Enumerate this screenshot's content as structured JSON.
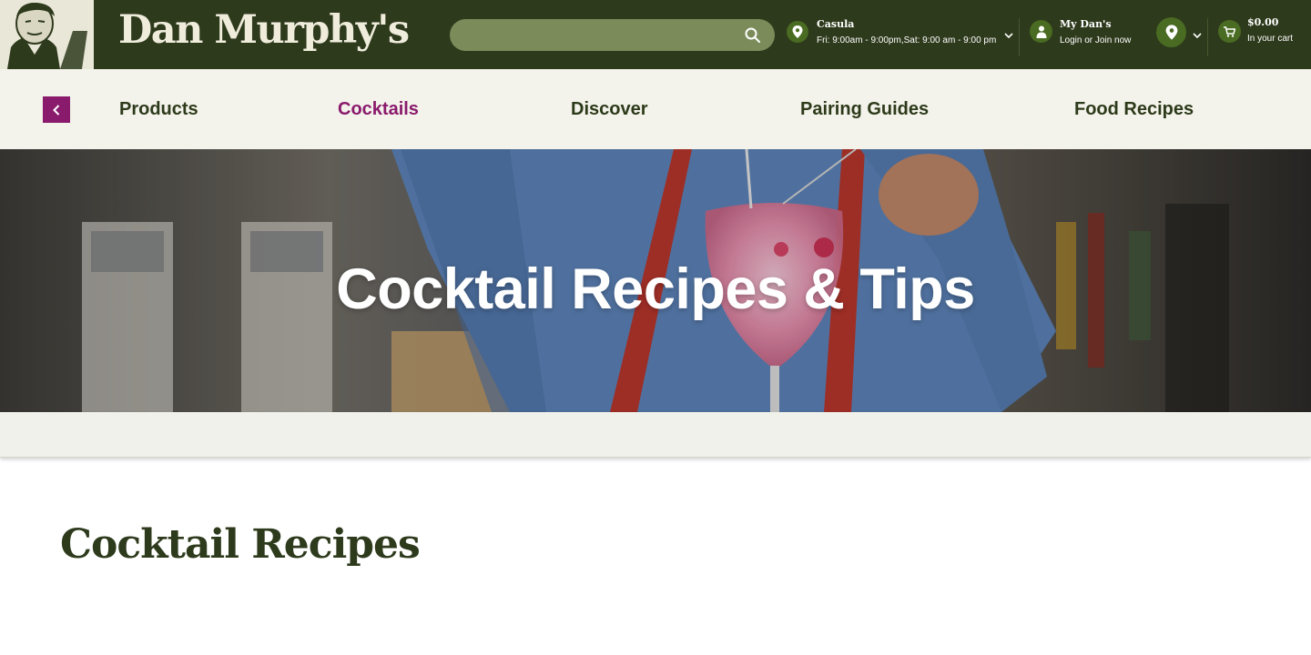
{
  "header": {
    "logo_text": "Dan Murphy's",
    "search": {
      "placeholder": "",
      "value": ""
    },
    "store": {
      "name": "Casula",
      "hours": "Fri: 9:00am - 9:00pm,Sat: 9:00 am - 9:00 pm"
    },
    "account": {
      "title": "My Dan's",
      "subtitle": "Login or Join now"
    },
    "cart": {
      "total": "$0.00",
      "subtitle": "In your cart"
    },
    "colors": {
      "header_bg": "#2e3a1c",
      "icon_bg": "#4a6b22",
      "search_bg": "#7b8c5a"
    }
  },
  "nav": {
    "items": [
      {
        "label": "Products",
        "active": false
      },
      {
        "label": "Cocktails",
        "active": true
      },
      {
        "label": "Discover",
        "active": false
      },
      {
        "label": "Pairing Guides",
        "active": false
      },
      {
        "label": "Food Recipes",
        "active": false
      }
    ],
    "colors": {
      "active": "#8a1a6c",
      "bg": "#f3f3eb"
    }
  },
  "hero": {
    "title": "Cocktail Recipes & Tips"
  },
  "section": {
    "title": "Cocktail Recipes"
  }
}
